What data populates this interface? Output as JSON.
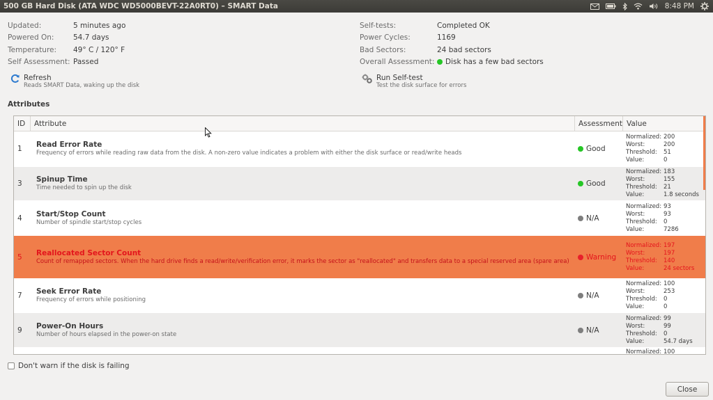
{
  "window": {
    "title": "500 GB Hard Disk (ATA WDC WD5000BEVT-22A0RT0) – SMART Data",
    "clock": "8:48 PM"
  },
  "summary_left": [
    {
      "label": "Updated:",
      "value": "5 minutes ago"
    },
    {
      "label": "Powered On:",
      "value": "54.7 days"
    },
    {
      "label": "Temperature:",
      "value": "49° C / 120° F"
    },
    {
      "label": "Self Assessment:",
      "value": "Passed"
    }
  ],
  "summary_right": [
    {
      "label": "Self-tests:",
      "value": "Completed OK"
    },
    {
      "label": "Power Cycles:",
      "value": "1169"
    },
    {
      "label": "Bad Sectors:",
      "value": "24 bad sectors"
    },
    {
      "label": "Overall Assessment:",
      "value": "Disk has a few bad sectors"
    }
  ],
  "actions": {
    "refresh": {
      "title": "Refresh",
      "desc": "Reads SMART Data, waking up the disk"
    },
    "selftest": {
      "title": "Run Self-test",
      "desc": "Test the disk surface for errors"
    }
  },
  "attributes": {
    "heading": "Attributes",
    "columns": {
      "id": "ID",
      "attribute": "Attribute",
      "assessment": "Assessment",
      "value": "Value"
    },
    "value_labels": {
      "normalized": "Normalized:",
      "worst": "Worst:",
      "threshold": "Threshold:",
      "value": "Value:"
    },
    "rows": [
      {
        "id": "1",
        "name": "Read Error Rate",
        "desc": "Frequency of errors while reading raw data from the disk. A non-zero value indicates a problem with either the disk surface or read/write heads",
        "assessment": "Good",
        "status": "green",
        "normalized": "200",
        "worst": "200",
        "threshold": "51",
        "value": "0"
      },
      {
        "id": "3",
        "name": "Spinup Time",
        "desc": "Time needed to spin up the disk",
        "assessment": "Good",
        "status": "green",
        "normalized": "183",
        "worst": "155",
        "threshold": "21",
        "value": "1.8 seconds"
      },
      {
        "id": "4",
        "name": "Start/Stop Count",
        "desc": "Number of spindle start/stop cycles",
        "assessment": "N/A",
        "status": "gray",
        "normalized": "93",
        "worst": "93",
        "threshold": "0",
        "value": "7286"
      },
      {
        "id": "5",
        "name": "Reallocated Sector Count",
        "desc": "Count of remapped sectors. When the hard drive finds a read/write/verification error, it marks the sector as \"reallocated\" and transfers data to a special reserved area (spare area)",
        "assessment": "Warning",
        "status": "red",
        "normalized": "197",
        "worst": "197",
        "threshold": "140",
        "value": "24 sectors"
      },
      {
        "id": "7",
        "name": "Seek Error Rate",
        "desc": "Frequency of errors while positioning",
        "assessment": "N/A",
        "status": "gray",
        "normalized": "100",
        "worst": "253",
        "threshold": "0",
        "value": "0"
      },
      {
        "id": "9",
        "name": "Power-On Hours",
        "desc": "Number of hours elapsed in the power-on state",
        "assessment": "N/A",
        "status": "gray",
        "normalized": "99",
        "worst": "99",
        "threshold": "0",
        "value": "54.7 days"
      },
      {
        "id": "",
        "name": "",
        "desc": "",
        "assessment": "",
        "status": "",
        "normalized": "100",
        "worst": "",
        "threshold": "",
        "value": ""
      }
    ]
  },
  "footer": {
    "checkbox_label": "Don't warn if the disk is failing",
    "close_label": "Close"
  }
}
